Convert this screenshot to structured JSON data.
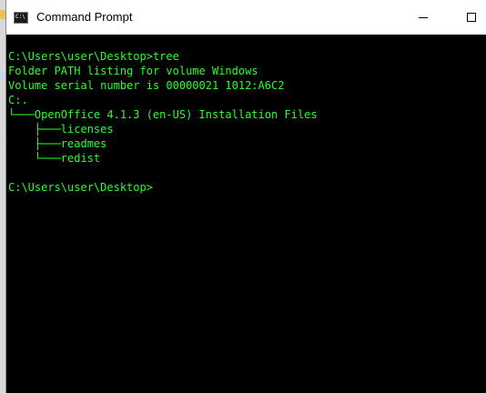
{
  "window": {
    "title": "Command Prompt",
    "icon": "cmd-icon",
    "icon_text": "C:\\"
  },
  "colors": {
    "console_bg": "#000000",
    "console_text": "#29ff2b",
    "title_bg": "#ffffff"
  },
  "console": {
    "lines": [
      "C:\\Users\\user\\Desktop>tree",
      "Folder PATH listing for volume Windows",
      "Volume serial number is 00000021 1012:A6C2",
      "C:.",
      "└───OpenOffice 4.1.3 (en-US) Installation Files",
      "    ├───licenses",
      "    ├───readmes",
      "    └───redist",
      "",
      "C:\\Users\\user\\Desktop>"
    ]
  }
}
